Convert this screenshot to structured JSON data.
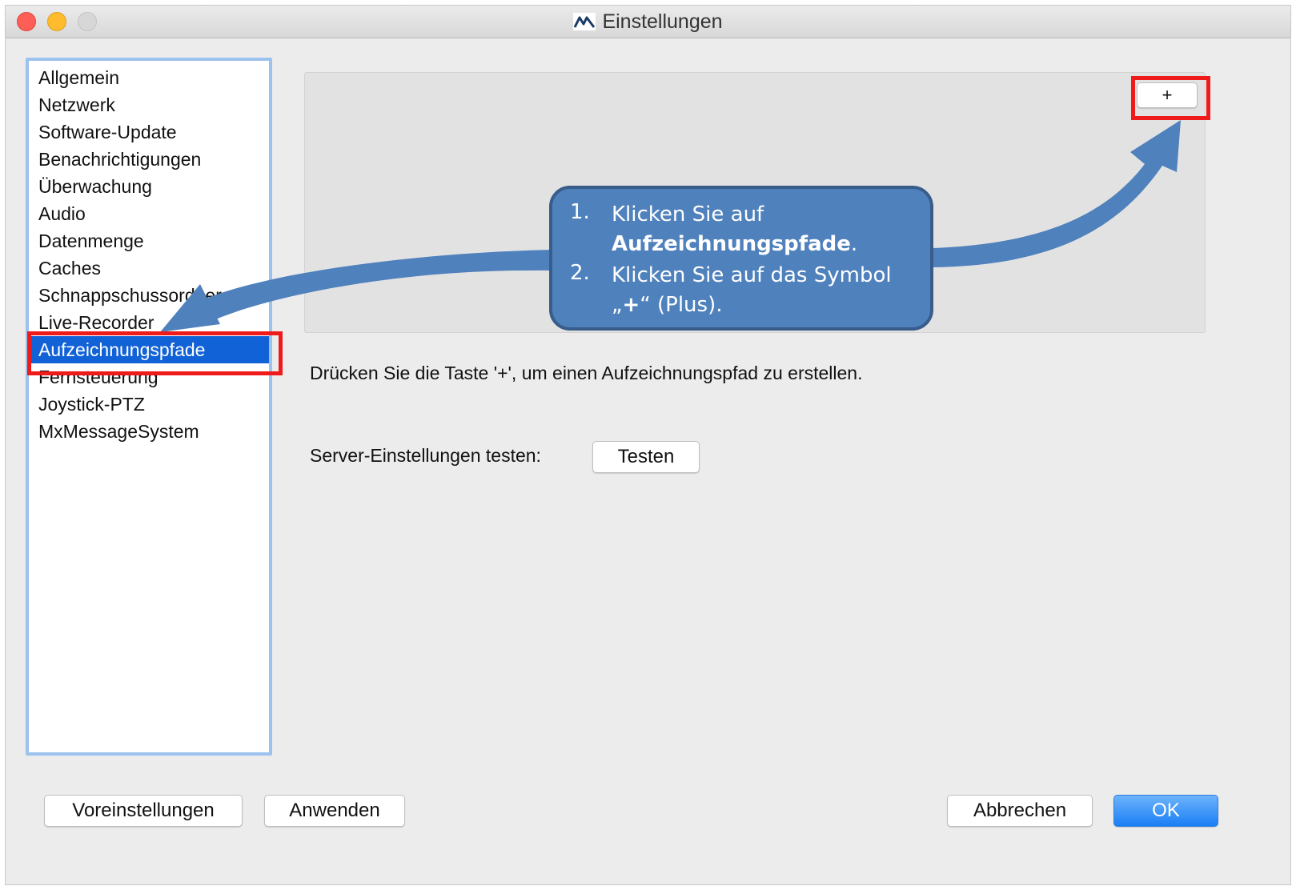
{
  "window": {
    "title": "Einstellungen"
  },
  "sidebar": {
    "items": [
      {
        "label": "Allgemein"
      },
      {
        "label": "Netzwerk"
      },
      {
        "label": "Software-Update"
      },
      {
        "label": "Benachrichtigungen"
      },
      {
        "label": "Überwachung"
      },
      {
        "label": "Audio"
      },
      {
        "label": "Datenmenge"
      },
      {
        "label": "Caches"
      },
      {
        "label": "Schnappschussordner"
      },
      {
        "label": "Live-Recorder"
      },
      {
        "label": "Aufzeichnungspfade",
        "selected": true
      },
      {
        "label": "Fernsteuerung"
      },
      {
        "label": "Joystick-PTZ"
      },
      {
        "label": "MxMessageSystem"
      }
    ]
  },
  "main": {
    "plus_label": "+",
    "hint": "Drücken Sie die Taste '+', um einen Aufzeichnungspfad zu erstellen.",
    "server_test_label": "Server-Einstellungen testen:",
    "test_button": "Testen"
  },
  "footer": {
    "defaults_button": "Voreinstellungen",
    "apply_button": "Anwenden",
    "cancel_button": "Abbrechen",
    "ok_button": "OK"
  },
  "callout": {
    "step1_num": "1.",
    "step1_text": "Klicken Sie auf",
    "step1_bold": "Aufzeichnungspfade",
    "step1_end": ".",
    "step2_num": "2.",
    "step2_text": "Klicken Sie auf das Symbol",
    "step2_quote_open": "„",
    "step2_bold": "+",
    "step2_end": "“ (Plus)."
  },
  "colors": {
    "selection": "#1162d6",
    "highlight": "#ef1b1b",
    "callout_fill": "#4f81bd",
    "ok_button": "#1a7ff5"
  }
}
